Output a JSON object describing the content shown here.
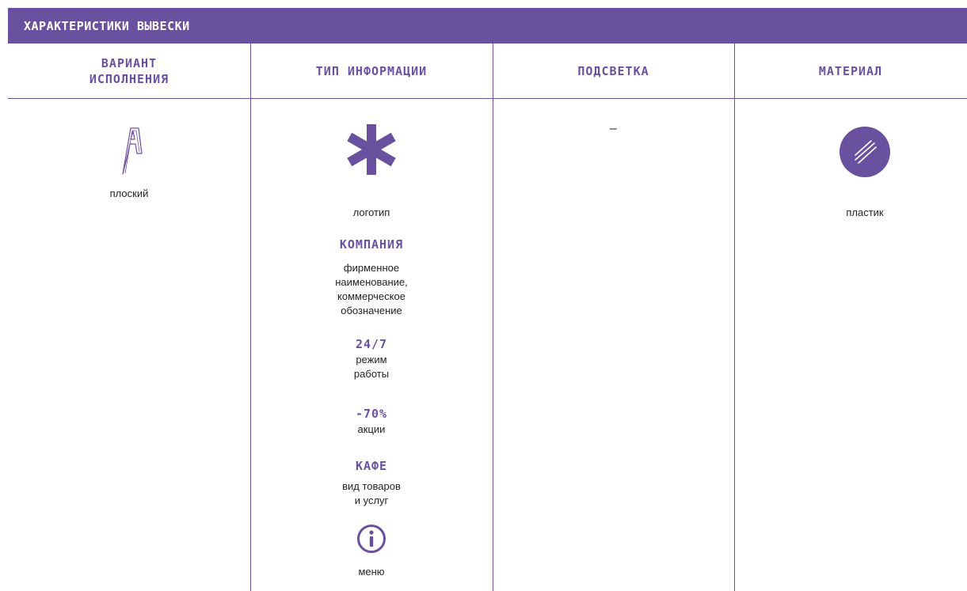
{
  "banner": {
    "title": "ХАРАКТЕРИСТИКИ ВЫВЕСКИ"
  },
  "headers": {
    "variant": "ВАРИАНТ ИСПОЛНЕНИЯ",
    "info_type": "ТИП ИНФОРМАЦИИ",
    "lighting": "ПОДСВЕТКА",
    "material": "МАТЕРИАЛ"
  },
  "variant": {
    "icon": "letter-a-outline-icon",
    "label": "плоский"
  },
  "info_type": {
    "logo": {
      "icon": "asterisk-icon",
      "label": "логотип"
    },
    "company": {
      "title": "КОМПАНИЯ",
      "label": "фирменное наименование, коммерческое обозначение"
    },
    "hours": {
      "title": "24/7",
      "label": "режим работы"
    },
    "promo": {
      "title": "-70%",
      "label": "акции"
    },
    "goods": {
      "title": "КАФЕ",
      "label": "вид товаров и услуг"
    },
    "menu": {
      "icon": "info-circle-icon",
      "label": "меню"
    }
  },
  "lighting": {
    "value": "–"
  },
  "material": {
    "icon": "plastic-stripes-icon",
    "label": "пластик"
  },
  "colors": {
    "accent": "#6a51a0"
  }
}
